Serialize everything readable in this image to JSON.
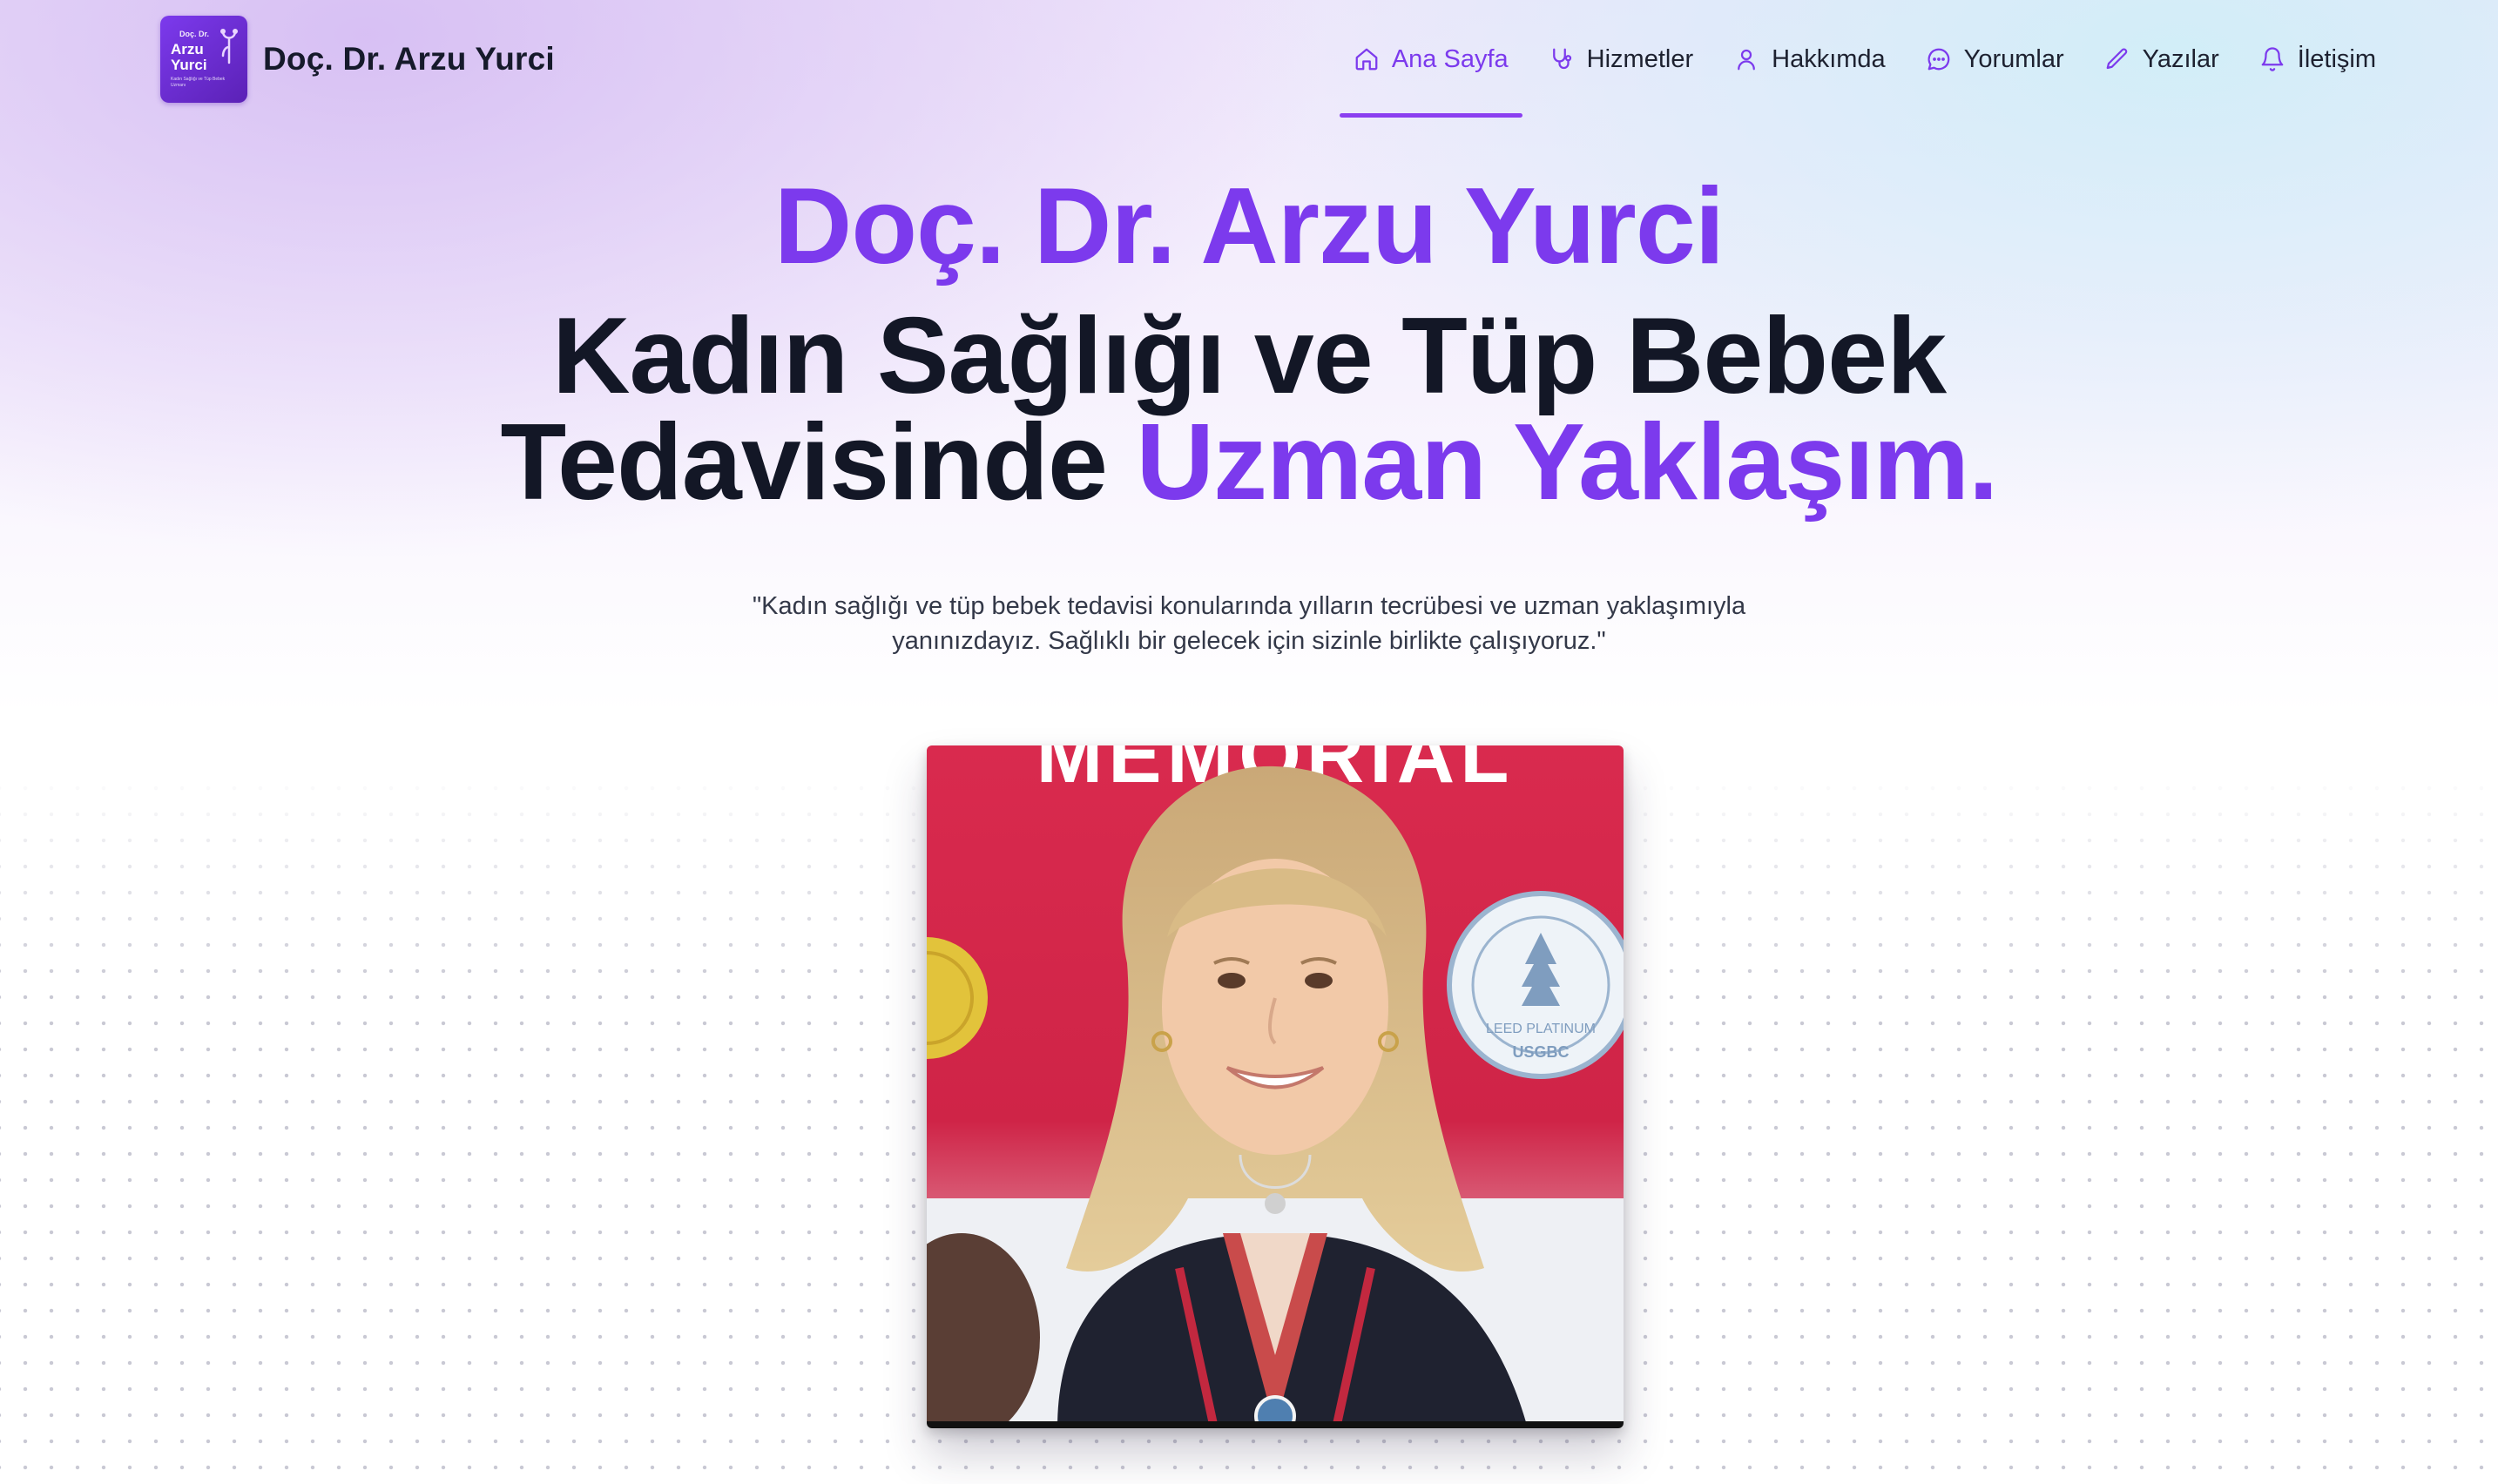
{
  "header": {
    "logo": {
      "line1": "Doç. Dr.",
      "line2": "Arzu",
      "line3": "Yurci",
      "tagline": "Kadın Sağlığı ve Tüp Bebek Uzmanı"
    },
    "brand_name": "Doç. Dr. Arzu Yurci",
    "nav": [
      {
        "label": "Ana Sayfa",
        "icon": "home-icon",
        "active": true
      },
      {
        "label": "Hizmetler",
        "icon": "stethoscope-icon",
        "active": false
      },
      {
        "label": "Hakkımda",
        "icon": "user-icon",
        "active": false
      },
      {
        "label": "Yorumlar",
        "icon": "chat-icon",
        "active": false
      },
      {
        "label": "Yazılar",
        "icon": "pencil-icon",
        "active": false
      },
      {
        "label": "İletişim",
        "icon": "bell-icon",
        "active": false
      }
    ]
  },
  "hero": {
    "name": "Doç. Dr. Arzu Yurci",
    "title_line1": "Kadın Sağlığı ve Tüp Bebek",
    "title_line2_plain": "Tedavisinde ",
    "title_line2_accent": "Uzman Yaklaşım.",
    "quote": "\"Kadın sağlığı ve tüp bebek tedavisi konularında yılların tecrübesi ve uzman yaklaşımıyla yanınızdayız. Sağlıklı bir gelecek için sizinle birlikte çalışıyoruz.\"",
    "photo_banner_text": "MEMORIAL",
    "photo_badge_text": "U.S. GREEN BUILDING COUNCIL",
    "photo_badge_sub": "LEED PLATINUM",
    "photo_badge_org": "USGBC"
  },
  "colors": {
    "accent": "#7c3aed",
    "text": "#131726"
  }
}
